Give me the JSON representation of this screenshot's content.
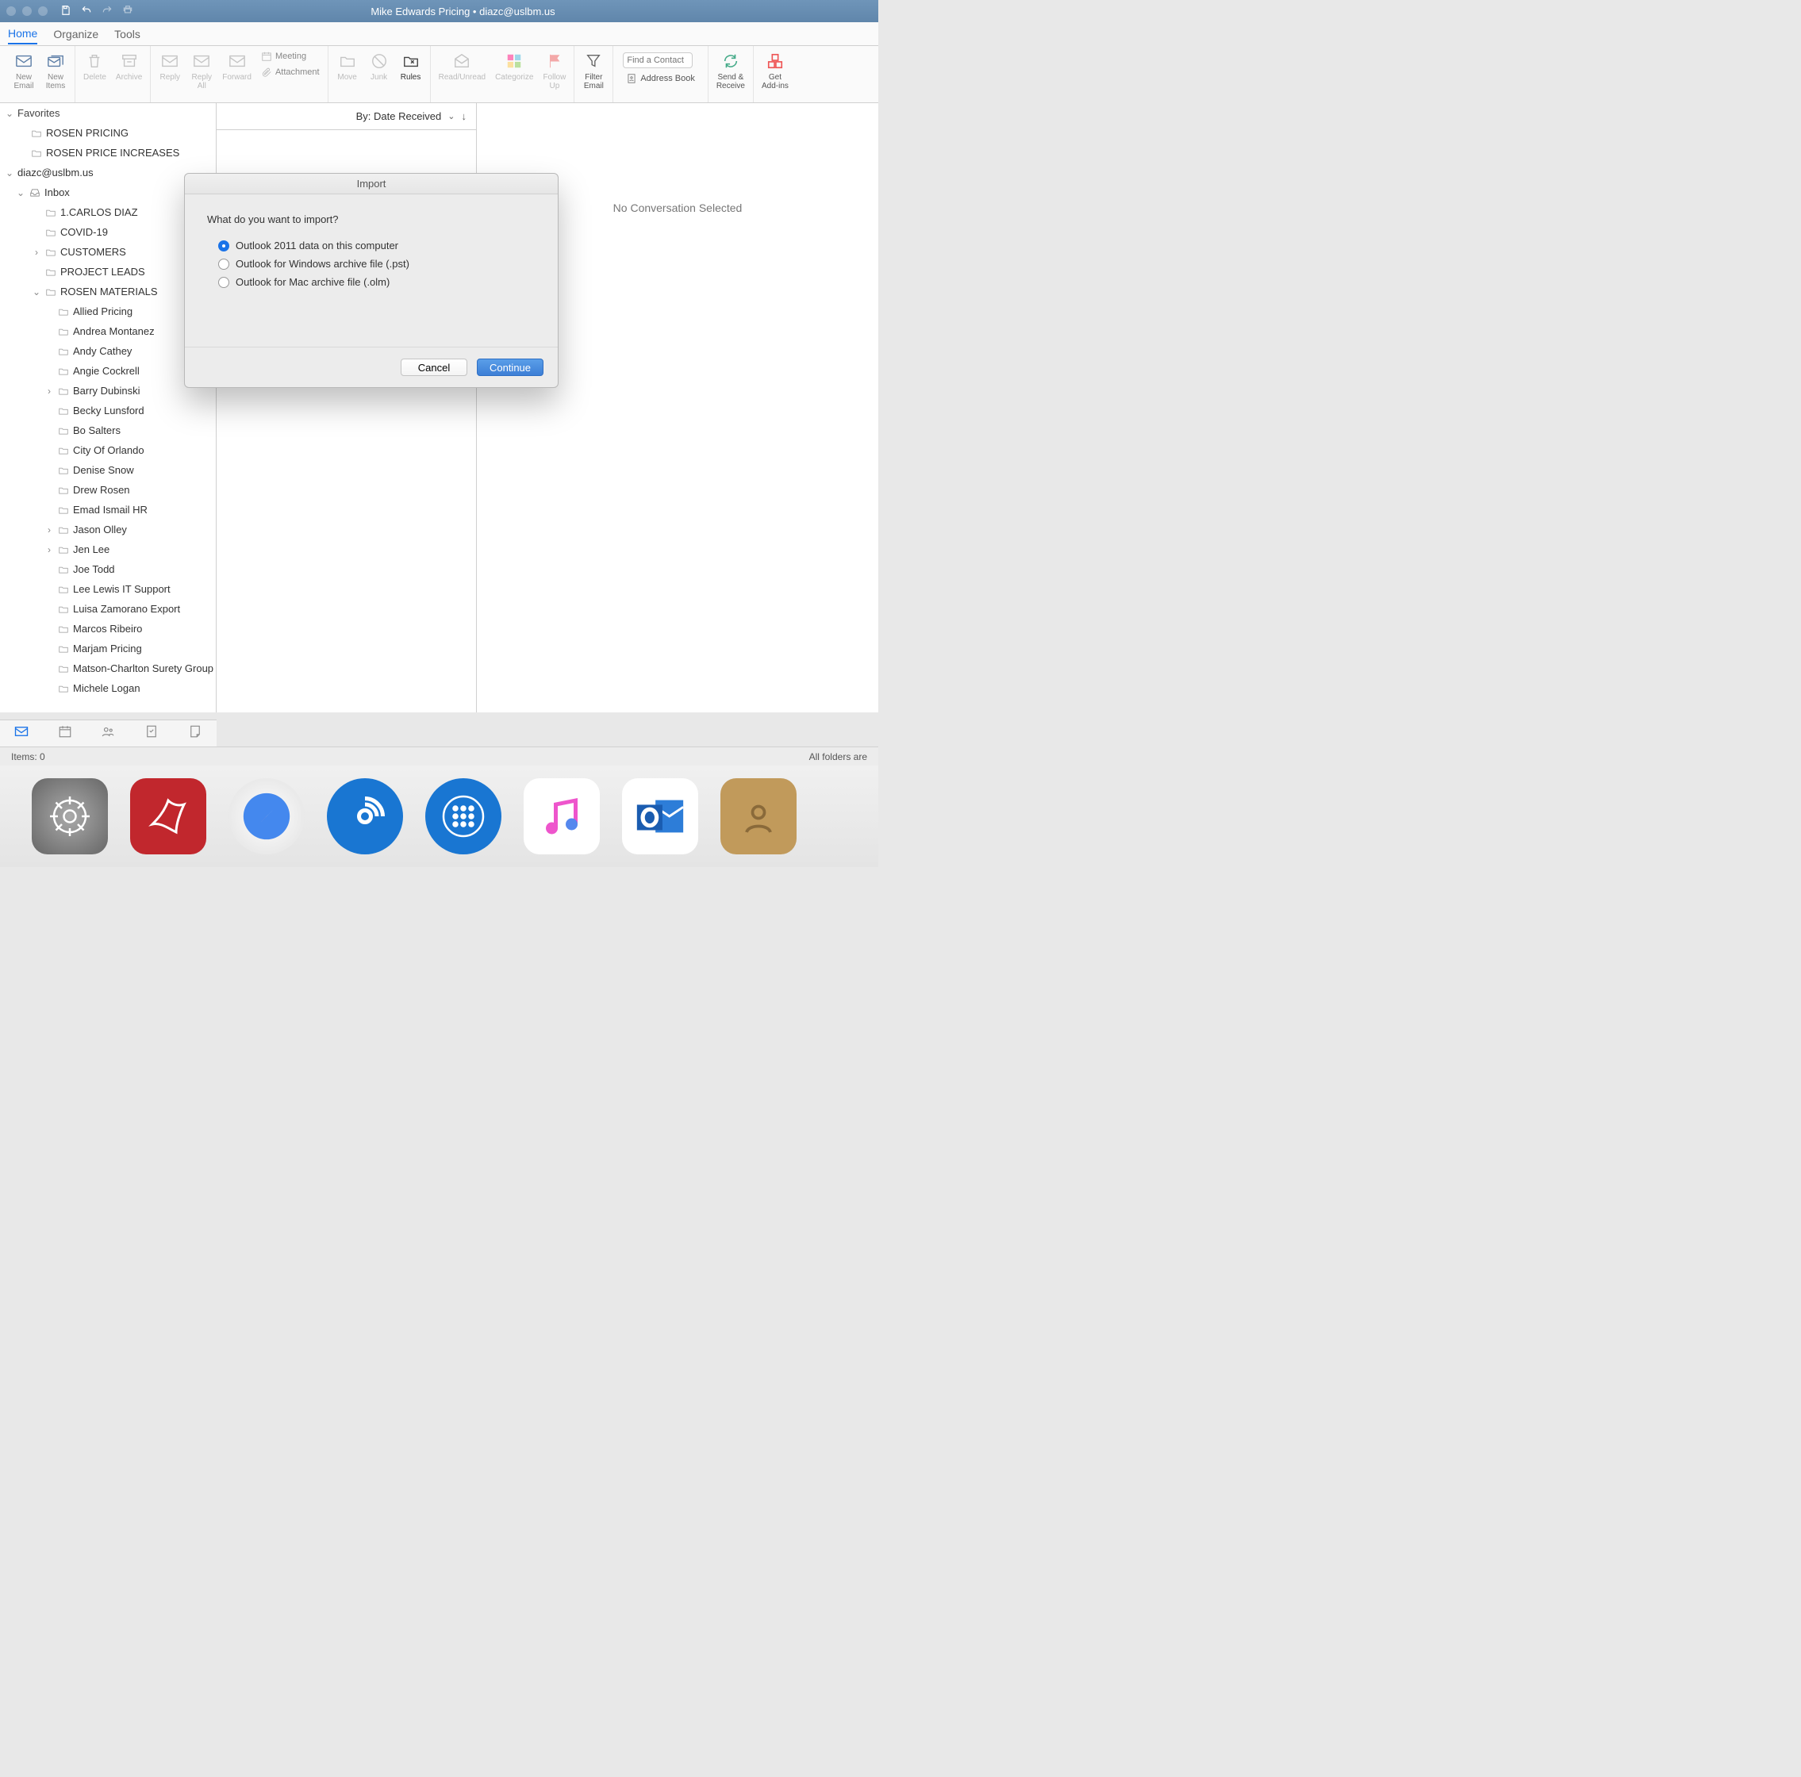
{
  "titlebar": {
    "title": "Mike Edwards Pricing • diazc@uslbm.us"
  },
  "tabs": {
    "home": "Home",
    "organize": "Organize",
    "tools": "Tools"
  },
  "ribbon": {
    "new_email": "New\nEmail",
    "new_items": "New\nItems",
    "delete": "Delete",
    "archive": "Archive",
    "reply": "Reply",
    "reply_all": "Reply\nAll",
    "forward": "Forward",
    "meeting": "Meeting",
    "attachment": "Attachment",
    "move": "Move",
    "junk": "Junk",
    "rules": "Rules",
    "read_unread": "Read/Unread",
    "categorize": "Categorize",
    "follow_up": "Follow\nUp",
    "filter_email": "Filter\nEmail",
    "find_contact_placeholder": "Find a Contact",
    "address_book": "Address Book",
    "send_receive": "Send &\nReceive",
    "get_addins": "Get\nAdd-ins"
  },
  "sidebar": {
    "favorites": "Favorites",
    "fav_items": [
      "ROSEN PRICING",
      "ROSEN PRICE INCREASES"
    ],
    "account": "diazc@uslbm.us",
    "inbox": "Inbox",
    "inbox_sub": [
      {
        "name": "1.CARLOS DIAZ",
        "exp": false,
        "disc": false
      },
      {
        "name": "COVID-19",
        "exp": false,
        "disc": false
      },
      {
        "name": "CUSTOMERS",
        "exp": false,
        "disc": true
      },
      {
        "name": "PROJECT LEADS",
        "exp": false,
        "disc": false
      },
      {
        "name": "ROSEN MATERIALS",
        "exp": true,
        "disc": true
      }
    ],
    "rosen_sub": [
      {
        "name": "Allied Pricing",
        "disc": false
      },
      {
        "name": "Andrea Montanez",
        "disc": false
      },
      {
        "name": "Andy Cathey",
        "disc": false
      },
      {
        "name": "Angie Cockrell",
        "disc": false
      },
      {
        "name": "Barry Dubinski",
        "disc": true
      },
      {
        "name": "Becky Lunsford",
        "disc": false
      },
      {
        "name": "Bo Salters",
        "disc": false
      },
      {
        "name": "City Of Orlando",
        "disc": false
      },
      {
        "name": "Denise Snow",
        "disc": false
      },
      {
        "name": "Drew Rosen",
        "disc": false
      },
      {
        "name": "Emad Ismail HR",
        "disc": false
      },
      {
        "name": "Jason Olley",
        "disc": true
      },
      {
        "name": "Jen Lee",
        "disc": true
      },
      {
        "name": "Joe Todd",
        "disc": false
      },
      {
        "name": "Lee Lewis IT Support",
        "disc": false
      },
      {
        "name": "Luisa Zamorano Export",
        "disc": false
      },
      {
        "name": "Marcos Ribeiro",
        "disc": false
      },
      {
        "name": "Marjam Pricing",
        "disc": false
      },
      {
        "name": "Matson-Charlton Surety Group",
        "disc": false
      },
      {
        "name": "Michele Logan",
        "disc": false
      }
    ]
  },
  "listhead": {
    "sort": "By: Date Received"
  },
  "reading": {
    "empty": "No Conversation Selected"
  },
  "status": {
    "items": "Items: 0",
    "sync": "All folders are"
  },
  "modal": {
    "title": "Import",
    "question": "What do you want to import?",
    "opts": [
      "Outlook 2011 data on this computer",
      "Outlook for Windows archive file (.pst)",
      "Outlook for Mac archive file (.olm)"
    ],
    "cancel": "Cancel",
    "continue": "Continue"
  }
}
